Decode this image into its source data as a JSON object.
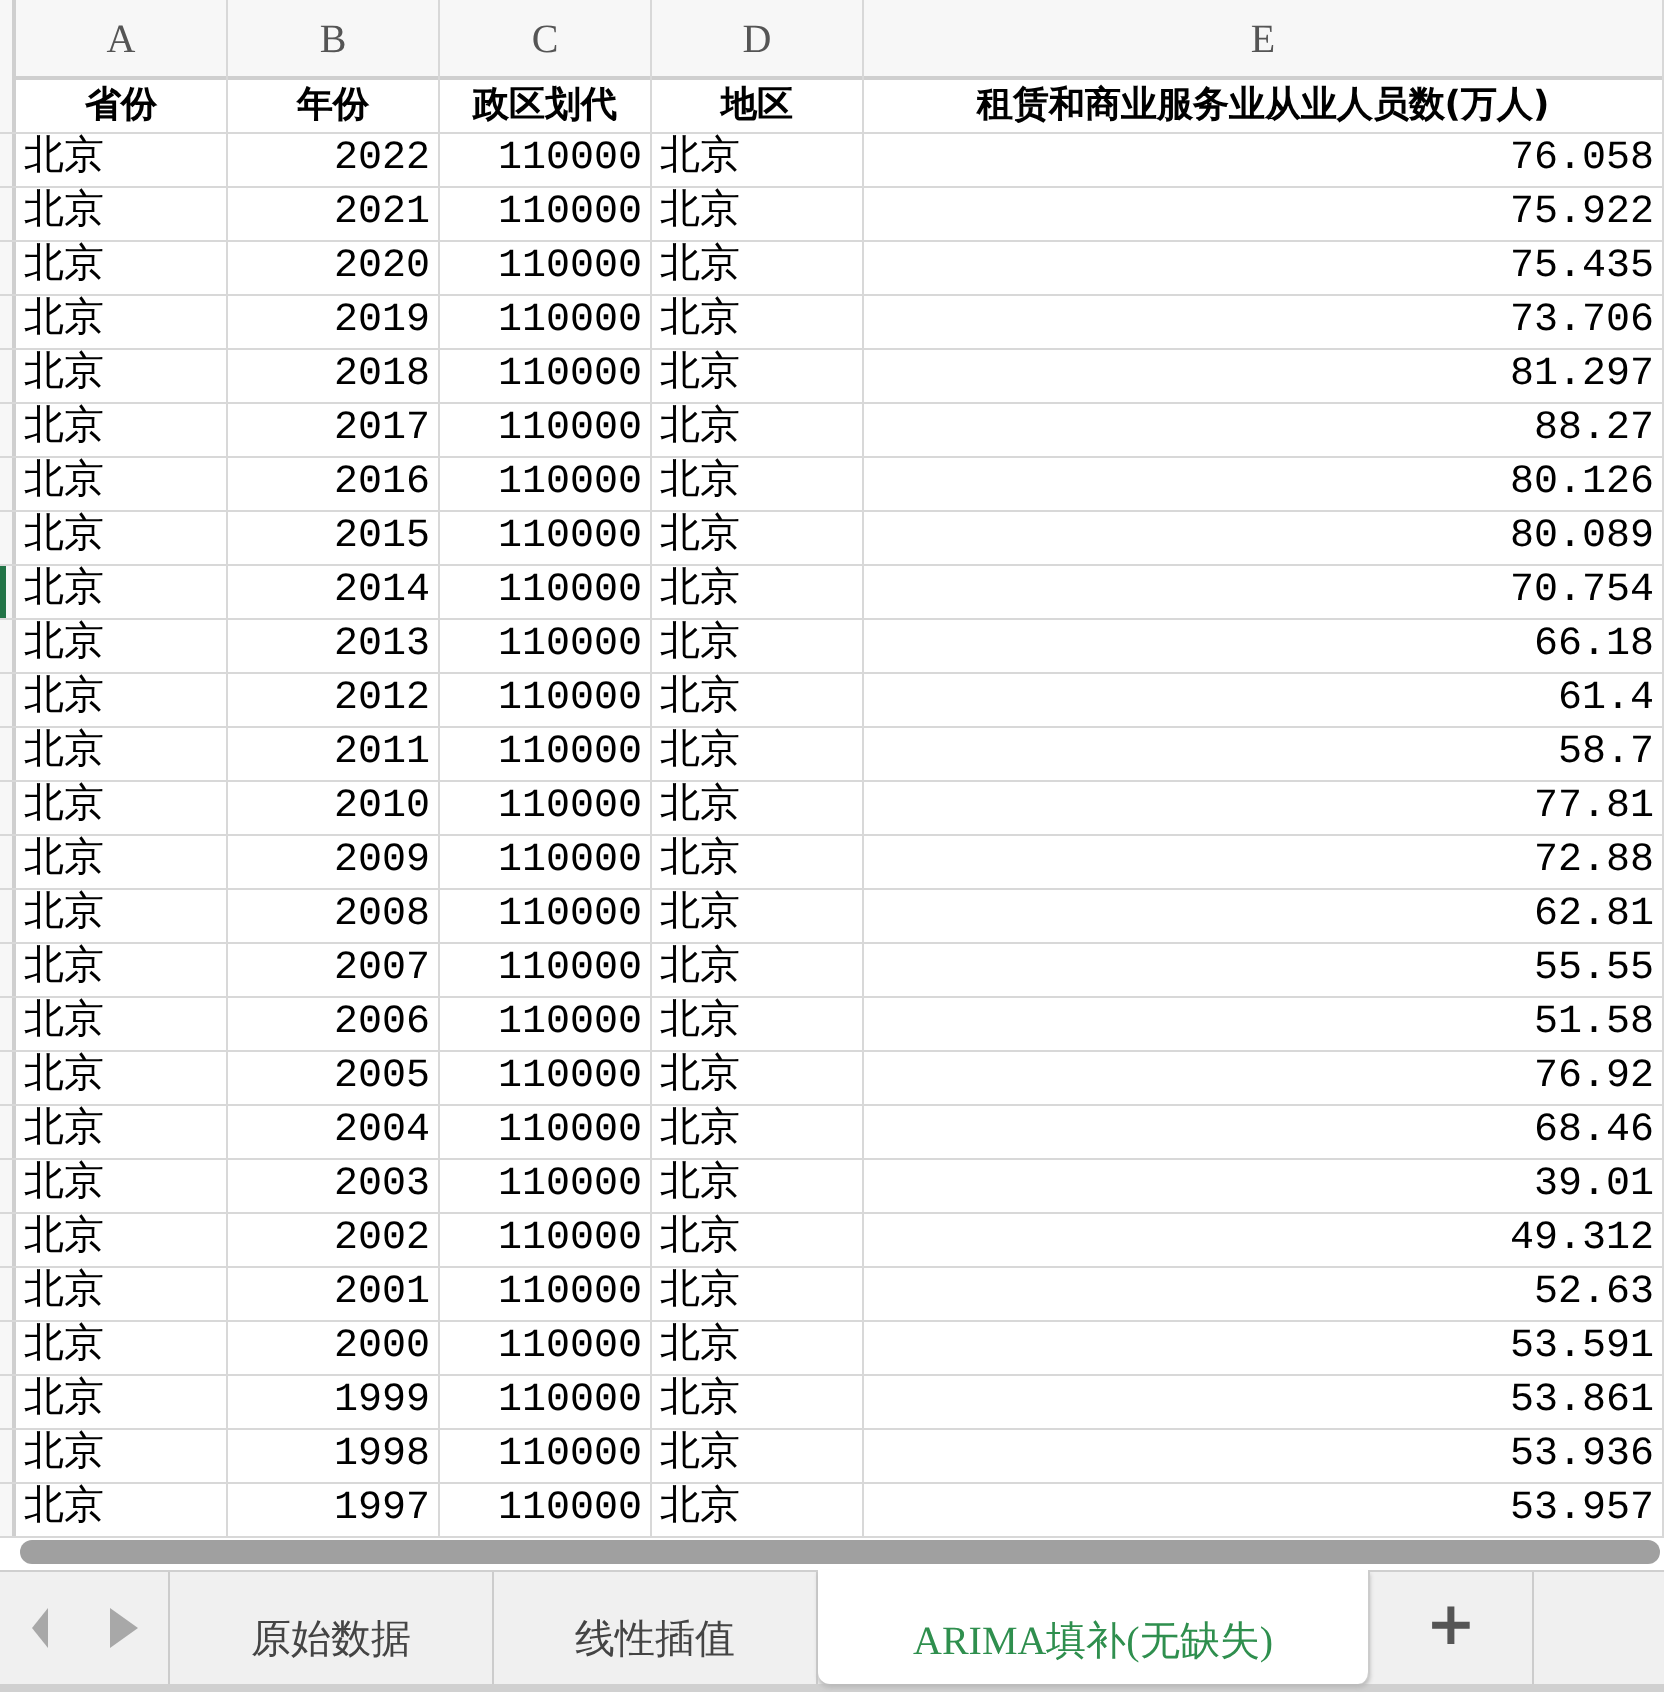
{
  "column_headers": [
    "A",
    "B",
    "C",
    "D",
    "E"
  ],
  "header_row": [
    "省份",
    "年份",
    "政区划代",
    "地区",
    "租赁和商业服务业从业人员数(万人)"
  ],
  "rows": [
    {
      "cells": [
        "北京",
        "2022",
        "110000",
        "北京",
        "76.058"
      ],
      "selected": false
    },
    {
      "cells": [
        "北京",
        "2021",
        "110000",
        "北京",
        "75.922"
      ],
      "selected": false
    },
    {
      "cells": [
        "北京",
        "2020",
        "110000",
        "北京",
        "75.435"
      ],
      "selected": false
    },
    {
      "cells": [
        "北京",
        "2019",
        "110000",
        "北京",
        "73.706"
      ],
      "selected": false
    },
    {
      "cells": [
        "北京",
        "2018",
        "110000",
        "北京",
        "81.297"
      ],
      "selected": false
    },
    {
      "cells": [
        "北京",
        "2017",
        "110000",
        "北京",
        "88.27"
      ],
      "selected": false
    },
    {
      "cells": [
        "北京",
        "2016",
        "110000",
        "北京",
        "80.126"
      ],
      "selected": false
    },
    {
      "cells": [
        "北京",
        "2015",
        "110000",
        "北京",
        "80.089"
      ],
      "selected": false
    },
    {
      "cells": [
        "北京",
        "2014",
        "110000",
        "北京",
        "70.754"
      ],
      "selected": true
    },
    {
      "cells": [
        "北京",
        "2013",
        "110000",
        "北京",
        "66.18"
      ],
      "selected": false
    },
    {
      "cells": [
        "北京",
        "2012",
        "110000",
        "北京",
        "61.4"
      ],
      "selected": false
    },
    {
      "cells": [
        "北京",
        "2011",
        "110000",
        "北京",
        "58.7"
      ],
      "selected": false
    },
    {
      "cells": [
        "北京",
        "2010",
        "110000",
        "北京",
        "77.81"
      ],
      "selected": false
    },
    {
      "cells": [
        "北京",
        "2009",
        "110000",
        "北京",
        "72.88"
      ],
      "selected": false
    },
    {
      "cells": [
        "北京",
        "2008",
        "110000",
        "北京",
        "62.81"
      ],
      "selected": false
    },
    {
      "cells": [
        "北京",
        "2007",
        "110000",
        "北京",
        "55.55"
      ],
      "selected": false
    },
    {
      "cells": [
        "北京",
        "2006",
        "110000",
        "北京",
        "51.58"
      ],
      "selected": false
    },
    {
      "cells": [
        "北京",
        "2005",
        "110000",
        "北京",
        "76.92"
      ],
      "selected": false
    },
    {
      "cells": [
        "北京",
        "2004",
        "110000",
        "北京",
        "68.46"
      ],
      "selected": false
    },
    {
      "cells": [
        "北京",
        "2003",
        "110000",
        "北京",
        "39.01"
      ],
      "selected": false
    },
    {
      "cells": [
        "北京",
        "2002",
        "110000",
        "北京",
        "49.312"
      ],
      "selected": false
    },
    {
      "cells": [
        "北京",
        "2001",
        "110000",
        "北京",
        "52.63"
      ],
      "selected": false
    },
    {
      "cells": [
        "北京",
        "2000",
        "110000",
        "北京",
        "53.591"
      ],
      "selected": false
    },
    {
      "cells": [
        "北京",
        "1999",
        "110000",
        "北京",
        "53.861"
      ],
      "selected": false
    },
    {
      "cells": [
        "北京",
        "1998",
        "110000",
        "北京",
        "53.936"
      ],
      "selected": false
    },
    {
      "cells": [
        "北京",
        "1997",
        "110000",
        "北京",
        "53.957"
      ],
      "selected": false
    }
  ],
  "sheet_tabs": [
    {
      "label": "原始数据",
      "selected": false
    },
    {
      "label": "线性插值",
      "selected": false
    },
    {
      "label": "ARIMA填补(无缺失)",
      "selected": true
    }
  ],
  "add_sheet": "+"
}
